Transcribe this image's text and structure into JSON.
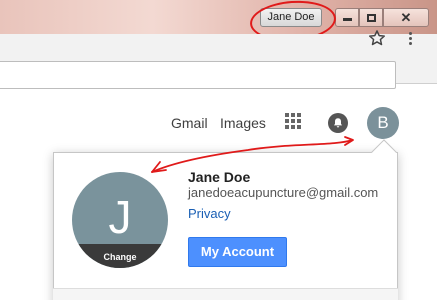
{
  "titlebar": {
    "profile_name": "Jane Doe",
    "minimize_icon": "minimize-icon",
    "maximize_icon": "maximize-icon",
    "close_icon": "close-icon",
    "close_glyph": "✕"
  },
  "toolbar": {
    "bookmark_icon": "star-icon",
    "menu_icon": "more-vert-icon"
  },
  "google_bar": {
    "gmail_label": "Gmail",
    "images_label": "Images",
    "apps_icon": "apps-grid-icon",
    "notifications_icon": "bell-icon",
    "avatar_letter": "B"
  },
  "account_popup": {
    "avatar_letter": "J",
    "change_label": "Change",
    "name": "Jane Doe",
    "email": "janedoeacupuncture@gmail.com",
    "privacy_label": "Privacy",
    "my_account_label": "My Account"
  },
  "annotations": {
    "color": "#e01a1a"
  },
  "colors": {
    "accent": "#4d90fe",
    "link": "#1a5fb4",
    "avatar": "#7a939c"
  }
}
